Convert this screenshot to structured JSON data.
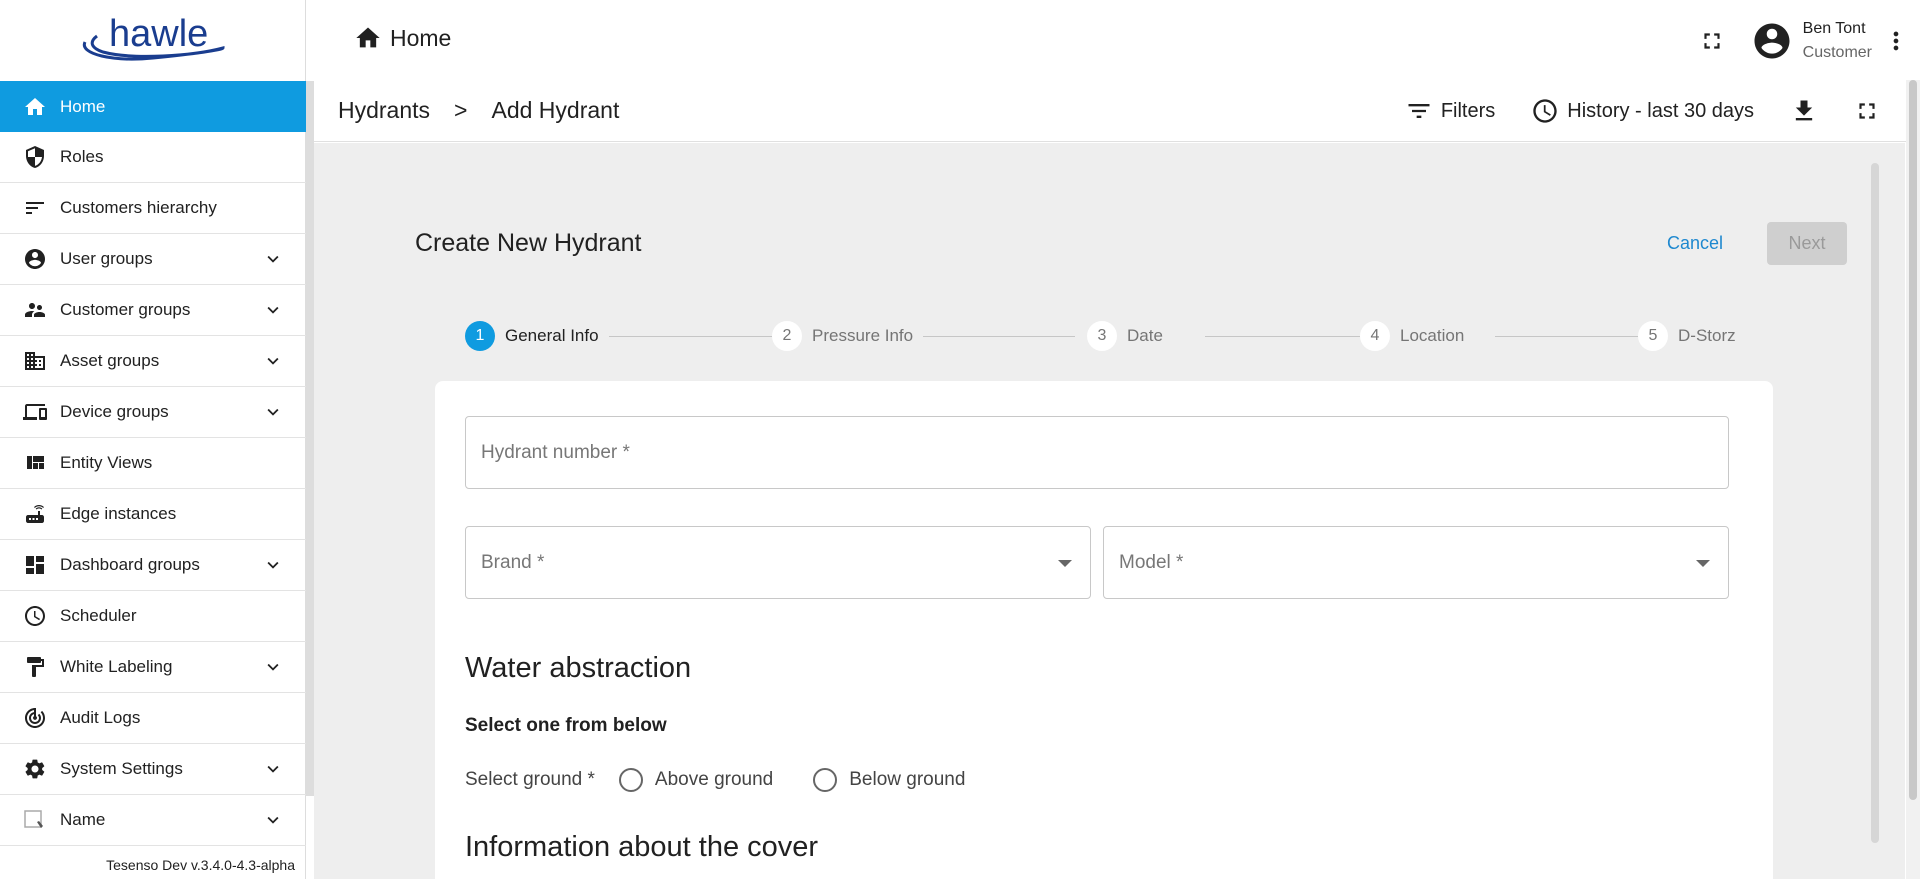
{
  "brand": {
    "logo_text": "hawle"
  },
  "sidebar": {
    "items": [
      {
        "label": "Home",
        "icon": "home-icon",
        "expandable": false,
        "active": true
      },
      {
        "label": "Roles",
        "icon": "shield-icon",
        "expandable": false
      },
      {
        "label": "Customers hierarchy",
        "icon": "sort-icon",
        "expandable": false
      },
      {
        "label": "User groups",
        "icon": "account-circle-icon",
        "expandable": true
      },
      {
        "label": "Customer groups",
        "icon": "supervisor-icon",
        "expandable": true
      },
      {
        "label": "Asset groups",
        "icon": "domain-icon",
        "expandable": true
      },
      {
        "label": "Device groups",
        "icon": "devices-icon",
        "expandable": true
      },
      {
        "label": "Entity Views",
        "icon": "view-quilt-icon",
        "expandable": false
      },
      {
        "label": "Edge instances",
        "icon": "router-icon",
        "expandable": false
      },
      {
        "label": "Dashboard groups",
        "icon": "dashboard-icon",
        "expandable": true
      },
      {
        "label": "Scheduler",
        "icon": "schedule-icon",
        "expandable": false
      },
      {
        "label": "White Labeling",
        "icon": "format-paint-icon",
        "expandable": true
      },
      {
        "label": "Audit Logs",
        "icon": "track-changes-icon",
        "expandable": false
      },
      {
        "label": "System Settings",
        "icon": "gear-icon",
        "expandable": true
      },
      {
        "label": "Name",
        "icon": "broken-image-icon",
        "expandable": true
      }
    ],
    "version": "Tesenso Dev v.3.4.0-4.3-alpha"
  },
  "header": {
    "title": "Home",
    "user": {
      "name": "Ben Tont",
      "role": "Customer"
    }
  },
  "subbar": {
    "breadcrumb": [
      "Hydrants",
      "Add Hydrant"
    ],
    "breadcrumb_sep": ">",
    "filters_label": "Filters",
    "history_label": "History - last 30 days"
  },
  "form": {
    "title": "Create New Hydrant",
    "cancel_label": "Cancel",
    "next_label": "Next",
    "steps": [
      {
        "num": "1",
        "label": "General Info",
        "active": true
      },
      {
        "num": "2",
        "label": "Pressure Info"
      },
      {
        "num": "3",
        "label": "Date"
      },
      {
        "num": "4",
        "label": "Location"
      },
      {
        "num": "5",
        "label": "D-Storz"
      }
    ],
    "hydrant_number_placeholder": "Hydrant number *",
    "brand_placeholder": "Brand *",
    "model_placeholder": "Model *",
    "water_section": "Water abstraction",
    "select_one": "Select one from below",
    "ground_label": "Select ground *",
    "radio_options": [
      "Above ground",
      "Below ground"
    ],
    "cover_section": "Information about the cover"
  },
  "colors": {
    "accent": "#0f9be0",
    "link": "#1e88cf",
    "content_bg": "#eeeeee"
  }
}
